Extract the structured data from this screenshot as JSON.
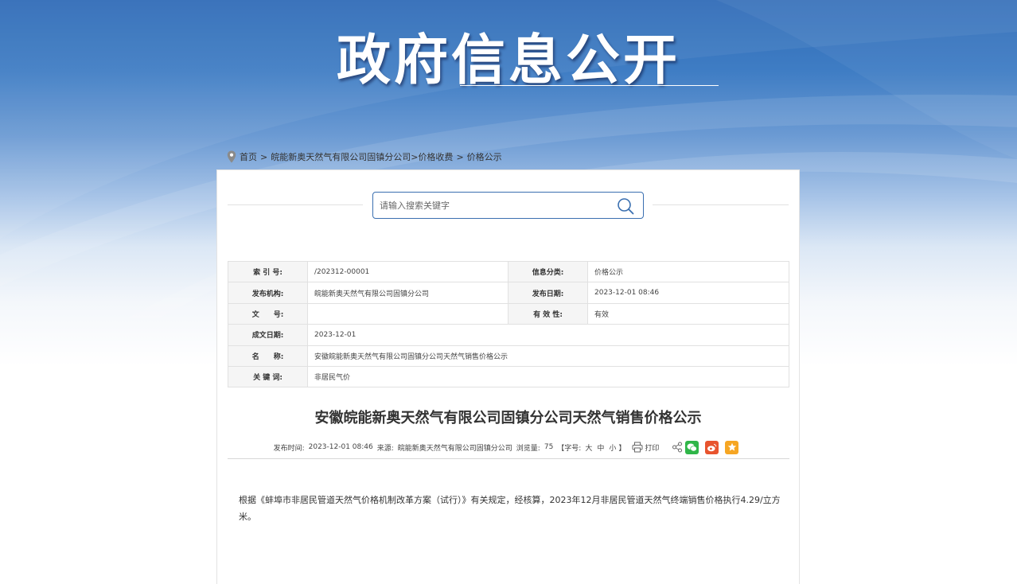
{
  "banner": {
    "title": "政府信息公开"
  },
  "breadcrumb": {
    "items": [
      "首页",
      "皖能新奥天然气有限公司固镇分公司",
      "价格收费",
      "价格公示"
    ],
    "sep1": ">",
    "sep2": ">",
    "sep3": ">"
  },
  "search": {
    "placeholder": "请输入搜索关键字"
  },
  "meta": {
    "index_label": "索 引 号:",
    "index_value": "/202312-00001",
    "category_label": "信息分类:",
    "category_value": "价格公示",
    "org_label": "发布机构:",
    "org_value": "皖能新奥天然气有限公司固镇分公司",
    "pubdate_label": "发布日期:",
    "pubdate_value": "2023-12-01 08:46",
    "docno_label": "文　　号:",
    "docno_value": "",
    "validity_label": "有 效 性:",
    "validity_value": "有效",
    "created_label": "成文日期:",
    "created_value": "2023-12-01",
    "name_label": "名　　称:",
    "name_value": "安徽皖能新奥天然气有限公司固镇分公司天然气销售价格公示",
    "keywords_label": "关 键 词:",
    "keywords_value": "非居民气价"
  },
  "article": {
    "title": "安徽皖能新奥天然气有限公司固镇分公司天然气销售价格公示",
    "info": {
      "time_label": "发布时间:",
      "time_value": "2023-12-01 08:46",
      "source_label": "来源:",
      "source_value": "皖能新奥天然气有限公司固镇分公司",
      "views_label": "浏览量:",
      "views_value": "75",
      "font_label": "【字号:",
      "font_large": "大",
      "font_medium": "中",
      "font_small": "小",
      "font_end": "】",
      "print_label": "打印"
    },
    "body": "根据《蚌埠市非居民管道天然气价格机制改革方案（试行）》有关规定，经核算，2023年12月非居民管道天然气终端销售价格执行4.29/立方米。"
  },
  "colors": {
    "banner_blue": "#2f6bb7",
    "search_border": "#3a6fb0",
    "wechat": "#2fb648",
    "weibo": "#e8542e",
    "favorite": "#f6a623"
  },
  "icons": [
    "location-pin-icon",
    "search-icon",
    "print-icon",
    "share-icon",
    "wechat-icon",
    "weibo-icon",
    "star-icon"
  ]
}
